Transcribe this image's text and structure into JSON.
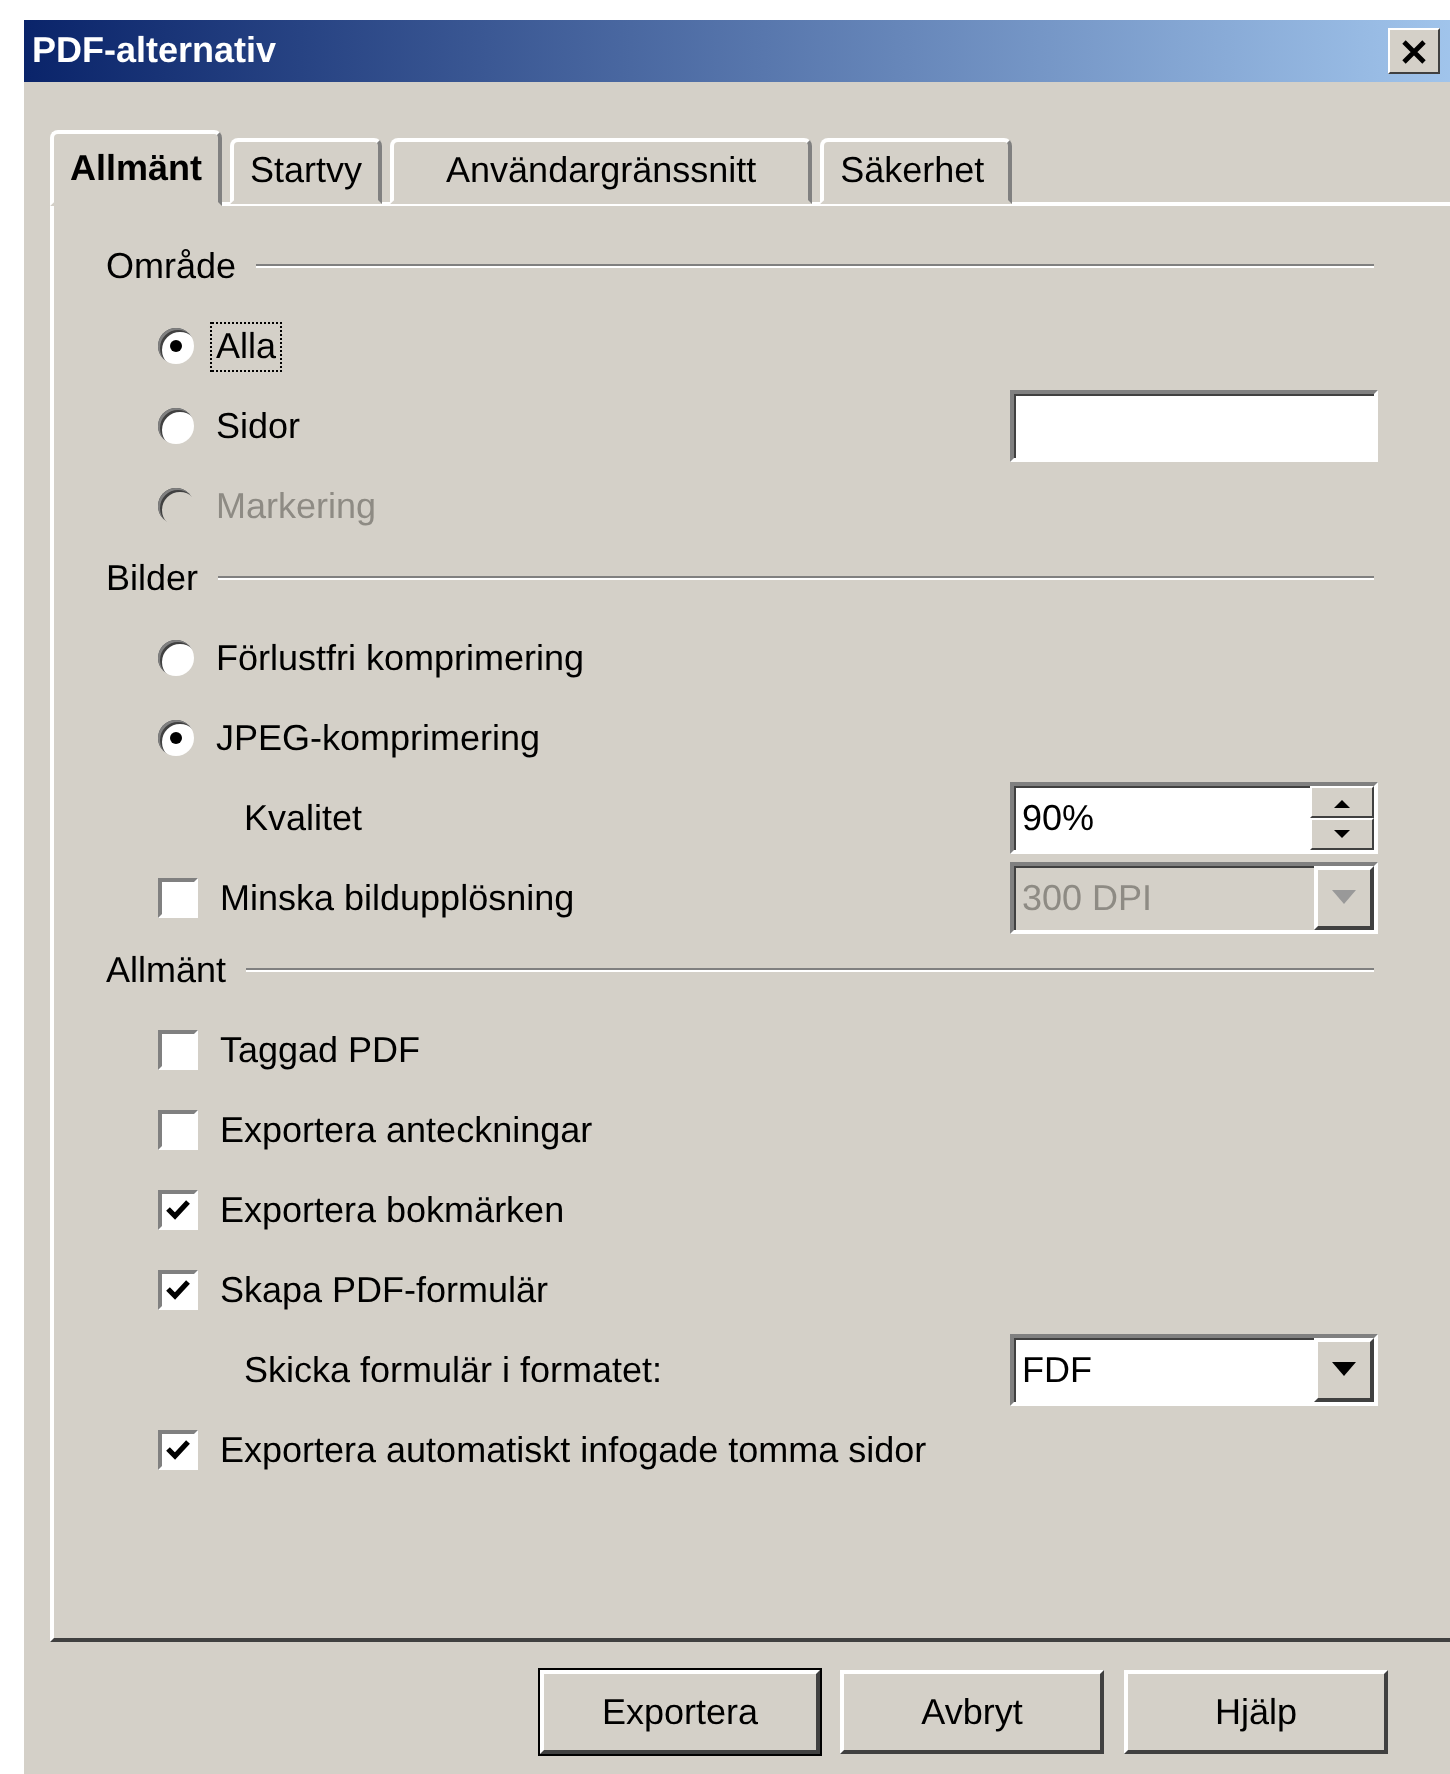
{
  "window": {
    "title": "PDF-alternativ"
  },
  "tabs": [
    {
      "label": "Allmänt",
      "selected": true
    },
    {
      "label": "Startvy",
      "selected": false
    },
    {
      "label": "Användargränssnitt",
      "selected": false
    },
    {
      "label": "Säkerhet",
      "selected": false
    }
  ],
  "sections": [
    {
      "title": "Område",
      "items": [
        {
          "kind": "radio",
          "label": "Alla",
          "selected": true,
          "disabled": false,
          "focused": true
        },
        {
          "kind": "radio",
          "label": "Sidor",
          "selected": false,
          "disabled": false,
          "focused": false,
          "control": {
            "kind": "text"
          }
        },
        {
          "kind": "radio",
          "label": "Markering",
          "selected": false,
          "disabled": true,
          "focused": false
        }
      ]
    },
    {
      "title": "Bilder",
      "items": [
        {
          "kind": "radio",
          "label": "Förlustfri komprimering",
          "selected": false,
          "disabled": false,
          "focused": false
        },
        {
          "kind": "radio",
          "label": "JPEG-komprimering",
          "selected": true,
          "disabled": false,
          "focused": false
        },
        {
          "kind": "label",
          "label": "Kvalitet",
          "control": {
            "kind": "spin",
            "value": "90%"
          }
        },
        {
          "kind": "checkbox",
          "label": "Minska bildupplösning",
          "checked": false,
          "control": {
            "kind": "dropdown",
            "value": "300 DPI",
            "disabled": true
          }
        }
      ]
    },
    {
      "title": "Allmänt",
      "items": [
        {
          "kind": "checkbox",
          "label": "Taggad PDF",
          "checked": false
        },
        {
          "kind": "checkbox",
          "label": "Exportera anteckningar",
          "checked": false
        },
        {
          "kind": "checkbox",
          "label": "Exportera bokmärken",
          "checked": true
        },
        {
          "kind": "checkbox",
          "label": "Skapa PDF-formulär",
          "checked": true
        },
        {
          "kind": "label",
          "label": "Skicka formulär i formatet:",
          "control": {
            "kind": "dropdown",
            "value": "FDF",
            "disabled": false
          }
        },
        {
          "kind": "checkbox",
          "label": "Exportera automatiskt infogade tomma sidor",
          "checked": true
        }
      ]
    }
  ],
  "buttons": [
    {
      "label": "Exportera",
      "default": true
    },
    {
      "label": "Avbryt",
      "default": false
    },
    {
      "label": "Hjälp",
      "default": false
    }
  ]
}
